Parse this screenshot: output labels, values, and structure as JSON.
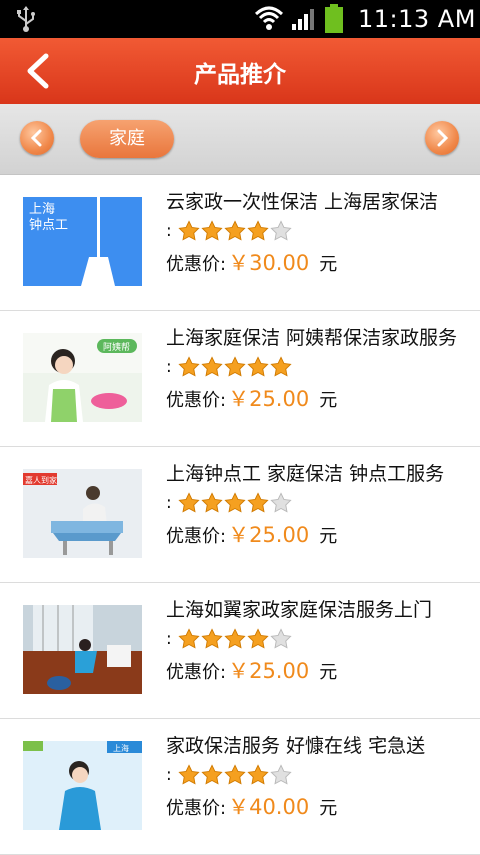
{
  "status_bar": {
    "time": "11:13 AM"
  },
  "header": {
    "title": "产品推介"
  },
  "category": {
    "selected": "家庭"
  },
  "colors": {
    "header": "#e84a26",
    "accent": "#f08a1c",
    "star_on": "#f5a020",
    "star_off": "#d0d0d0"
  },
  "products": [
    {
      "name": "云家政一次性保洁 上海居家保洁",
      "rating_prefix": ":",
      "stars": 4,
      "price_label": "优惠价:",
      "price": "￥30.00",
      "unit": "元",
      "thumb_text": "上海\n钟点工"
    },
    {
      "name": "上海家庭保洁 阿姨帮保洁家政服务",
      "rating_prefix": ":",
      "stars": 5,
      "price_label": "优惠价:",
      "price": "￥25.00",
      "unit": "元",
      "thumb_text": "阿姨帮"
    },
    {
      "name": "上海钟点工 家庭保洁 钟点工服务",
      "rating_prefix": ":",
      "stars": 4,
      "price_label": "优惠价:",
      "price": "￥25.00",
      "unit": "元",
      "thumb_text": "嘉人到家"
    },
    {
      "name": "上海如翼家政家庭保洁服务上门",
      "rating_prefix": ":",
      "stars": 4,
      "price_label": "优惠价:",
      "price": "￥25.00",
      "unit": "元",
      "thumb_text": ""
    },
    {
      "name": "家政保洁服务 好慷在线 宅急送",
      "rating_prefix": ":",
      "stars": 4,
      "price_label": "优惠价:",
      "price": "￥40.00",
      "unit": "元",
      "thumb_text": "上海"
    }
  ]
}
